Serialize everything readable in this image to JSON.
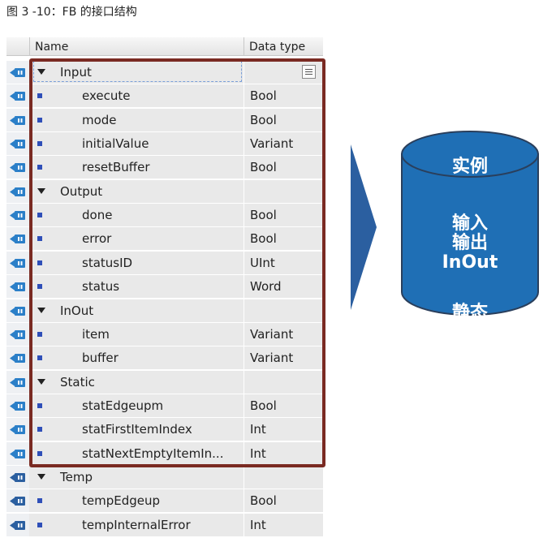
{
  "caption": "图 3 -10：FB 的接口结构",
  "table": {
    "headers": {
      "name": "Name",
      "datatype": "Data type"
    },
    "rows": [
      {
        "kind": "section",
        "name": "Input",
        "type": ""
      },
      {
        "kind": "item",
        "name": "execute",
        "type": "Bool"
      },
      {
        "kind": "item",
        "name": "mode",
        "type": "Bool"
      },
      {
        "kind": "item",
        "name": "initialValue",
        "type": "Variant"
      },
      {
        "kind": "item",
        "name": "resetBuffer",
        "type": "Bool"
      },
      {
        "kind": "section",
        "name": "Output",
        "type": ""
      },
      {
        "kind": "item",
        "name": "done",
        "type": "Bool"
      },
      {
        "kind": "item",
        "name": "error",
        "type": "Bool"
      },
      {
        "kind": "item",
        "name": "statusID",
        "type": "UInt"
      },
      {
        "kind": "item",
        "name": "status",
        "type": "Word"
      },
      {
        "kind": "section",
        "name": "InOut",
        "type": ""
      },
      {
        "kind": "item",
        "name": "item",
        "type": "Variant"
      },
      {
        "kind": "item",
        "name": "buffer",
        "type": "Variant"
      },
      {
        "kind": "section",
        "name": "Static",
        "type": ""
      },
      {
        "kind": "item",
        "name": "statEdgeupm",
        "type": "Bool"
      },
      {
        "kind": "item",
        "name": "statFirstItemIndex",
        "type": "Int"
      },
      {
        "kind": "item",
        "name": "statNextEmptyItemIn...",
        "type": "Int"
      },
      {
        "kind": "section",
        "name": "Temp",
        "type": ""
      },
      {
        "kind": "item",
        "name": "tempEdgeup",
        "type": "Bool"
      },
      {
        "kind": "item",
        "name": "tempInternalError",
        "type": "Int"
      }
    ]
  },
  "cylinder": {
    "top_label": "实例",
    "line1": "输入",
    "line2": "输出",
    "line3": "InOut",
    "bottom_label": "静态"
  },
  "colors": {
    "frame": "#7a2a22",
    "cylinder": "#1f6fb5",
    "arrow": "#2b5fa0",
    "bullet": "#2f4fb8"
  }
}
